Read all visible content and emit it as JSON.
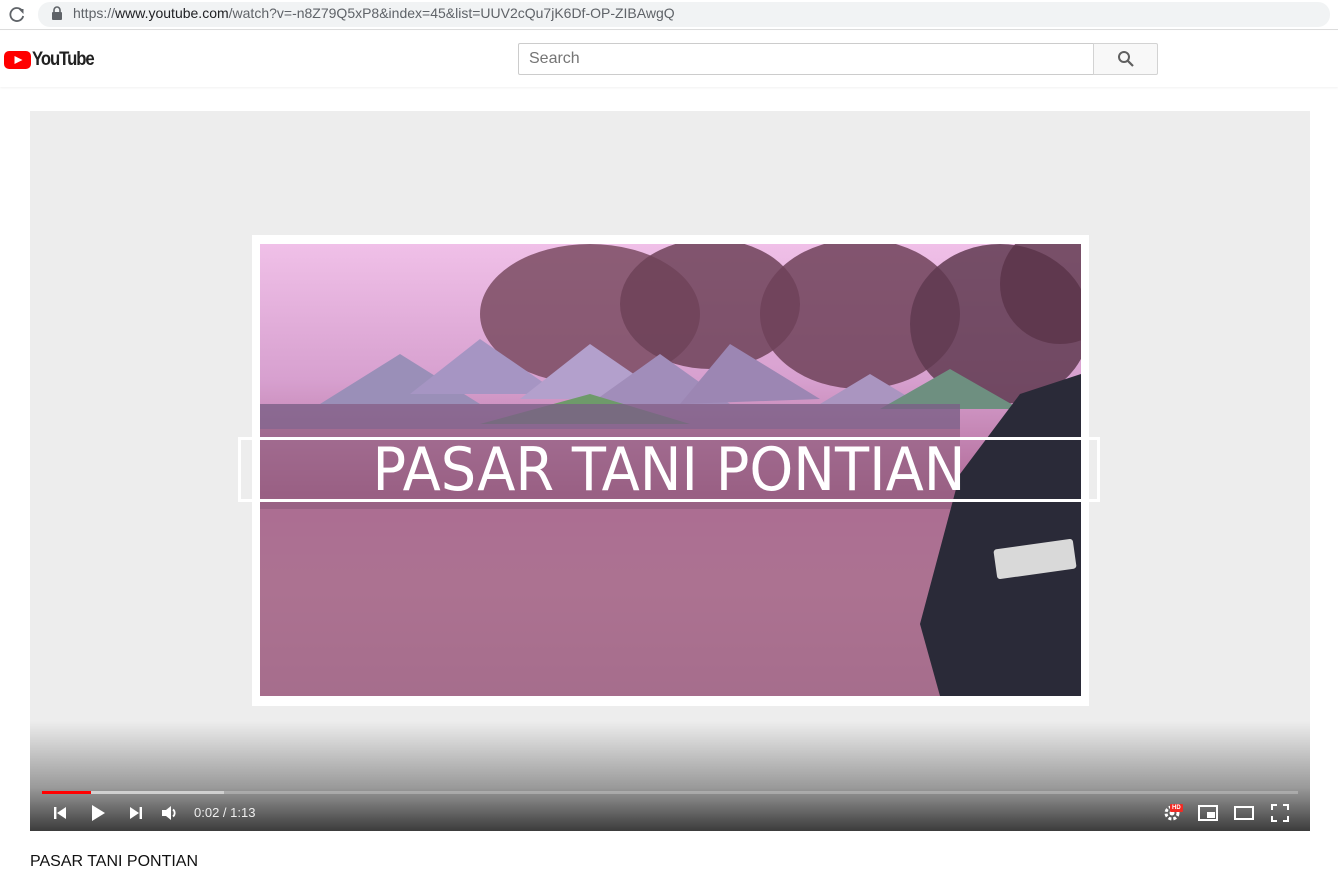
{
  "browser": {
    "url_scheme": "https://",
    "url_host": "www.youtube.com",
    "url_path": "/watch?v=-n8Z79Q5xP8&index=45&list=UUV2cQu7jK6Df-OP-ZIBAwgQ",
    "icons": [
      "reload-icon",
      "lock-icon"
    ]
  },
  "header": {
    "logo_text": "YouTube",
    "search_placeholder": "Search",
    "search_icon": "search-icon"
  },
  "player": {
    "overlay_title": "PASAR TANI PONTIAN",
    "current_time": "0:02",
    "time_separator": " / ",
    "duration": "1:13",
    "played_fraction": 0.039,
    "loaded_fraction": 0.145,
    "hd_badge": "HD",
    "controls": [
      "previous-icon",
      "play-icon",
      "next-icon",
      "volume-icon",
      "settings-icon",
      "miniplayer-icon",
      "theater-mode-icon",
      "fullscreen-icon"
    ],
    "colors": {
      "progress": "#ff0000",
      "youtube_red": "#ff0000"
    }
  },
  "video": {
    "title": "PASAR TANI PONTIAN"
  }
}
